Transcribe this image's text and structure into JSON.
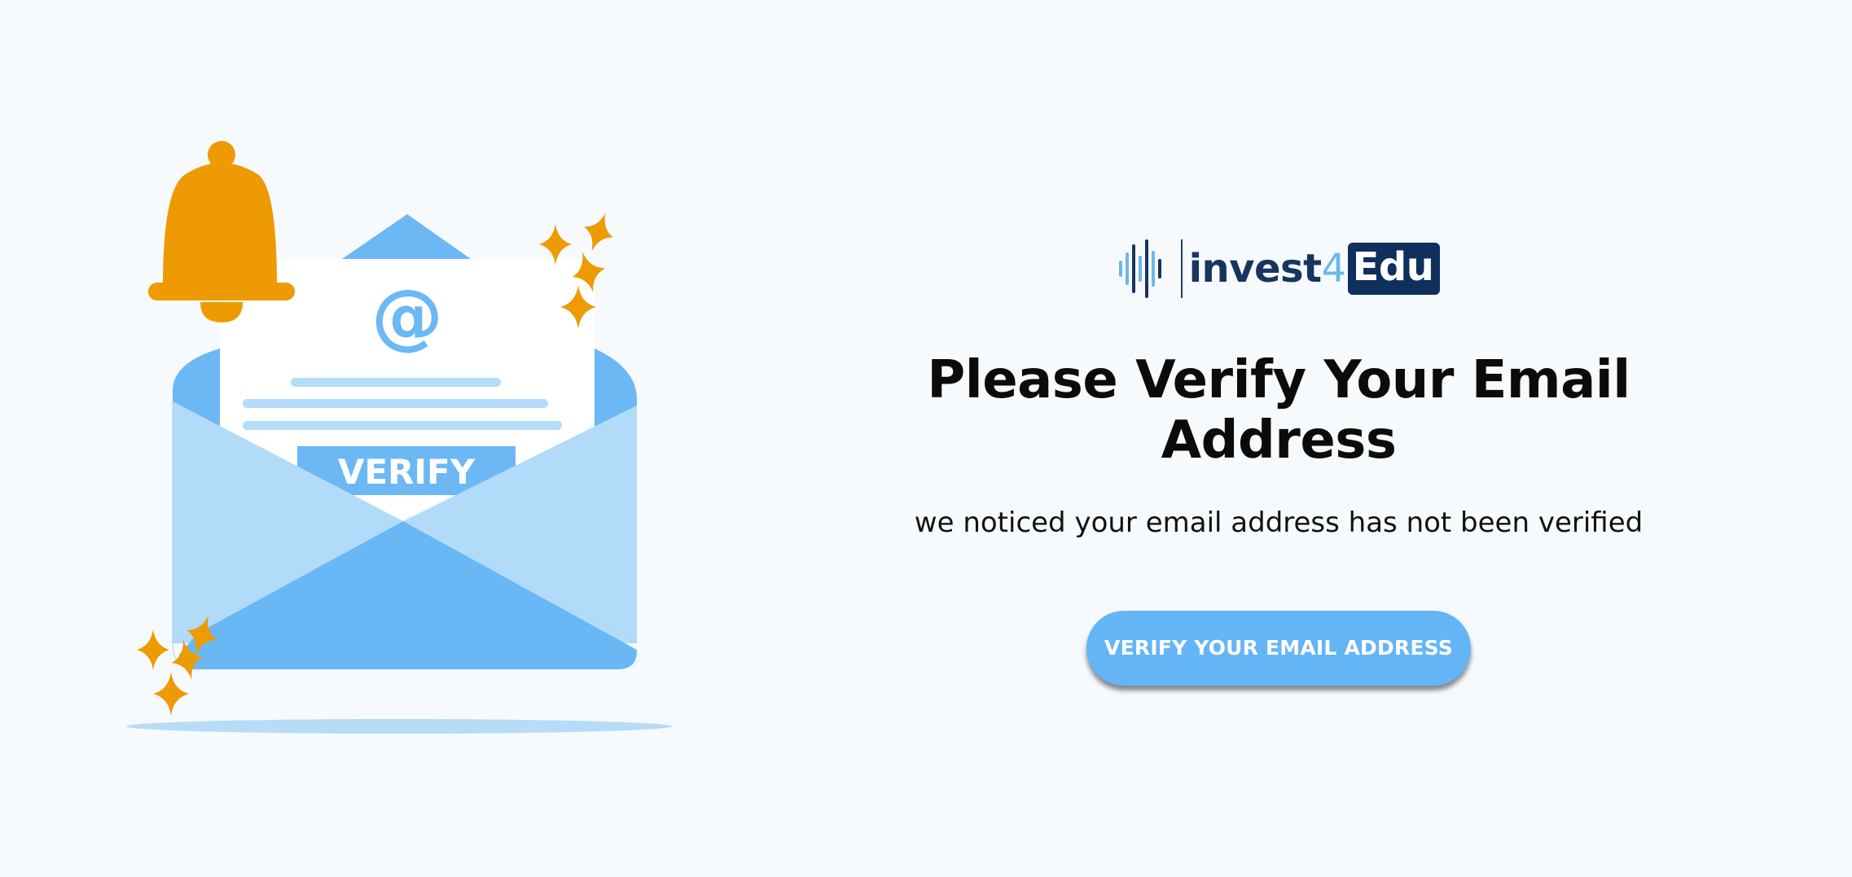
{
  "brand": {
    "name_prefix": "invest",
    "name_number": "4",
    "name_suffix": "Edu",
    "colors": {
      "navy": "#0f2f5d",
      "accent_blue": "#6db7ea",
      "button_blue": "#64b5f6",
      "orange": "#ee9a03"
    }
  },
  "illustration": {
    "verify_label": "VERIFY",
    "at_symbol": "@"
  },
  "main": {
    "title": "Please Verify Your Email Address",
    "subtitle": "we noticed your email address has not been verified",
    "verify_button_label": "VERIFY YOUR EMAIL ADDRESS"
  }
}
